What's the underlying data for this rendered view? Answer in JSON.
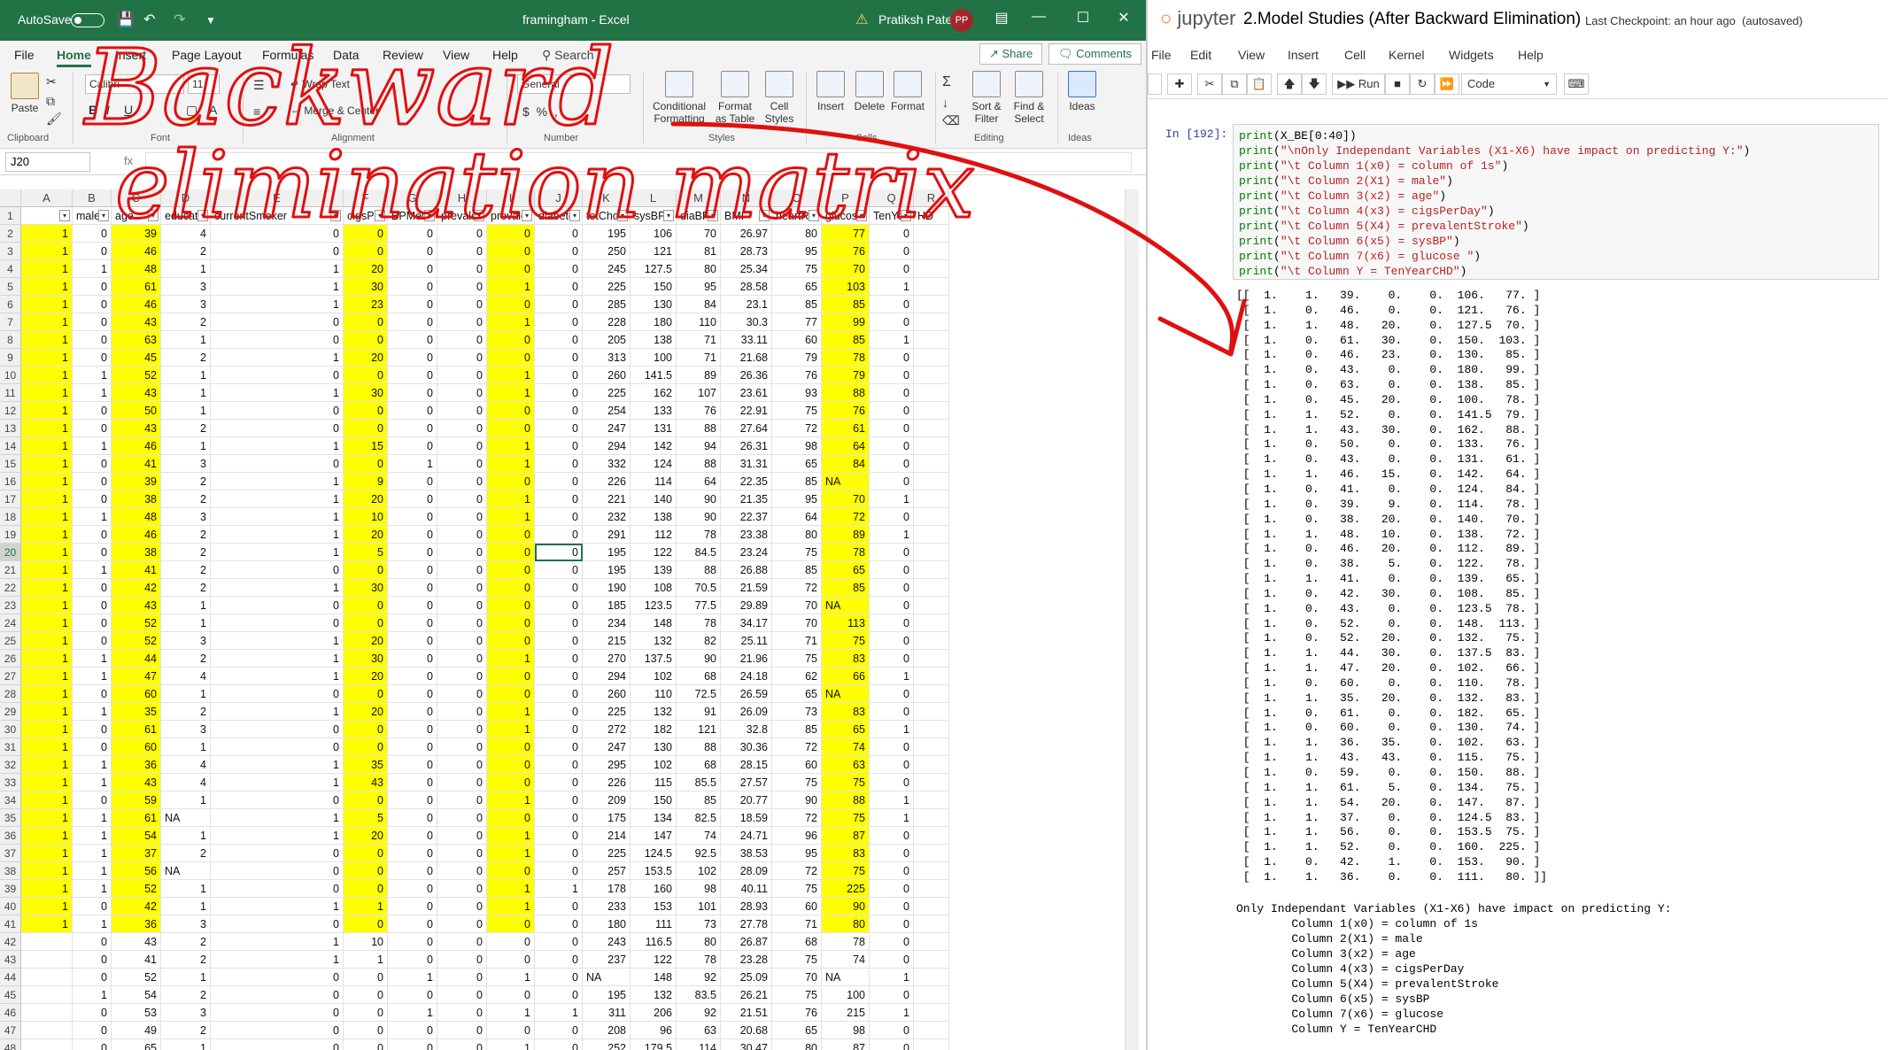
{
  "excel": {
    "autosave_label": "AutoSave",
    "toggle_state": "Off",
    "file_title": "framingham - Excel",
    "user_name": "Pratiksh Patel",
    "user_initials": "PP",
    "tabs": [
      "File",
      "Home",
      "Insert",
      "Page Layout",
      "Formulas",
      "Data",
      "Review",
      "View",
      "Help"
    ],
    "active_tab": "Home",
    "search_label": "Search",
    "share_label": "Share",
    "comments_label": "Comments",
    "ribbon": {
      "paste": "Paste",
      "clipboard": "Clipboard",
      "font_name": "Calibri",
      "font_size": "11",
      "font": "Font",
      "wrap": "Wrap Text",
      "merge": "Merge & Center",
      "alignment": "Alignment",
      "number_format": "General",
      "number": "Number",
      "conditional": "Conditional Formatting",
      "format_table": "Format as Table",
      "cell_styles": "Cell Styles",
      "styles": "Styles",
      "insert": "Insert",
      "delete": "Delete",
      "format": "Format",
      "cells": "Cells",
      "sort_filter": "Sort & Filter",
      "find_select": "Find & Select",
      "editing": "Editing",
      "ideas_btn": "Ideas",
      "ideas": "Ideas"
    },
    "name_box": "J20",
    "fx": "fx",
    "columns": [
      "A",
      "B",
      "C",
      "D",
      "E",
      "F",
      "G",
      "H",
      "I",
      "J",
      "K",
      "L",
      "M",
      "N",
      "O",
      "P",
      "Q",
      "R"
    ],
    "headers": [
      "",
      "male",
      "age",
      "educati",
      "currentSmoker",
      "cigsPer",
      "BPMed",
      "prevale",
      "prevale",
      "diabete",
      "totChol",
      "sysBP",
      "diaBP",
      "BMI",
      "heartRa",
      "glucose",
      "TenYea",
      "HD"
    ],
    "rows": [
      [
        "1",
        "0",
        "39",
        "4",
        "0",
        "0",
        "0",
        "0",
        "0",
        "0",
        "195",
        "106",
        "70",
        "26.97",
        "80",
        "77",
        "0"
      ],
      [
        "1",
        "0",
        "46",
        "2",
        "0",
        "0",
        "0",
        "0",
        "0",
        "0",
        "250",
        "121",
        "81",
        "28.73",
        "95",
        "76",
        "0"
      ],
      [
        "1",
        "1",
        "48",
        "1",
        "1",
        "20",
        "0",
        "0",
        "0",
        "0",
        "245",
        "127.5",
        "80",
        "25.34",
        "75",
        "70",
        "0"
      ],
      [
        "1",
        "0",
        "61",
        "3",
        "1",
        "30",
        "0",
        "0",
        "1",
        "0",
        "225",
        "150",
        "95",
        "28.58",
        "65",
        "103",
        "1"
      ],
      [
        "1",
        "0",
        "46",
        "3",
        "1",
        "23",
        "0",
        "0",
        "0",
        "0",
        "285",
        "130",
        "84",
        "23.1",
        "85",
        "85",
        "0"
      ],
      [
        "1",
        "0",
        "43",
        "2",
        "0",
        "0",
        "0",
        "0",
        "1",
        "0",
        "228",
        "180",
        "110",
        "30.3",
        "77",
        "99",
        "0"
      ],
      [
        "1",
        "0",
        "63",
        "1",
        "0",
        "0",
        "0",
        "0",
        "0",
        "0",
        "205",
        "138",
        "71",
        "33.11",
        "60",
        "85",
        "1"
      ],
      [
        "1",
        "0",
        "45",
        "2",
        "1",
        "20",
        "0",
        "0",
        "0",
        "0",
        "313",
        "100",
        "71",
        "21.68",
        "79",
        "78",
        "0"
      ],
      [
        "1",
        "1",
        "52",
        "1",
        "0",
        "0",
        "0",
        "0",
        "1",
        "0",
        "260",
        "141.5",
        "89",
        "26.36",
        "76",
        "79",
        "0"
      ],
      [
        "1",
        "1",
        "43",
        "1",
        "1",
        "30",
        "0",
        "0",
        "1",
        "0",
        "225",
        "162",
        "107",
        "23.61",
        "93",
        "88",
        "0"
      ],
      [
        "1",
        "0",
        "50",
        "1",
        "0",
        "0",
        "0",
        "0",
        "0",
        "0",
        "254",
        "133",
        "76",
        "22.91",
        "75",
        "76",
        "0"
      ],
      [
        "1",
        "0",
        "43",
        "2",
        "0",
        "0",
        "0",
        "0",
        "0",
        "0",
        "247",
        "131",
        "88",
        "27.64",
        "72",
        "61",
        "0"
      ],
      [
        "1",
        "1",
        "46",
        "1",
        "1",
        "15",
        "0",
        "0",
        "1",
        "0",
        "294",
        "142",
        "94",
        "26.31",
        "98",
        "64",
        "0"
      ],
      [
        "1",
        "0",
        "41",
        "3",
        "0",
        "0",
        "1",
        "0",
        "1",
        "0",
        "332",
        "124",
        "88",
        "31.31",
        "65",
        "84",
        "0"
      ],
      [
        "1",
        "0",
        "39",
        "2",
        "1",
        "9",
        "0",
        "0",
        "0",
        "0",
        "226",
        "114",
        "64",
        "22.35",
        "85",
        "NA",
        "0"
      ],
      [
        "1",
        "0",
        "38",
        "2",
        "1",
        "20",
        "0",
        "0",
        "1",
        "0",
        "221",
        "140",
        "90",
        "21.35",
        "95",
        "70",
        "1"
      ],
      [
        "1",
        "1",
        "48",
        "3",
        "1",
        "10",
        "0",
        "0",
        "1",
        "0",
        "232",
        "138",
        "90",
        "22.37",
        "64",
        "72",
        "0"
      ],
      [
        "1",
        "0",
        "46",
        "2",
        "1",
        "20",
        "0",
        "0",
        "0",
        "0",
        "291",
        "112",
        "78",
        "23.38",
        "80",
        "89",
        "1"
      ],
      [
        "1",
        "0",
        "38",
        "2",
        "1",
        "5",
        "0",
        "0",
        "0",
        "0",
        "195",
        "122",
        "84.5",
        "23.24",
        "75",
        "78",
        "0"
      ],
      [
        "1",
        "1",
        "41",
        "2",
        "0",
        "0",
        "0",
        "0",
        "0",
        "0",
        "195",
        "139",
        "88",
        "26.88",
        "85",
        "65",
        "0"
      ],
      [
        "1",
        "0",
        "42",
        "2",
        "1",
        "30",
        "0",
        "0",
        "0",
        "0",
        "190",
        "108",
        "70.5",
        "21.59",
        "72",
        "85",
        "0"
      ],
      [
        "1",
        "0",
        "43",
        "1",
        "0",
        "0",
        "0",
        "0",
        "0",
        "0",
        "185",
        "123.5",
        "77.5",
        "29.89",
        "70",
        "NA",
        "0"
      ],
      [
        "1",
        "0",
        "52",
        "1",
        "0",
        "0",
        "0",
        "0",
        "0",
        "0",
        "234",
        "148",
        "78",
        "34.17",
        "70",
        "113",
        "0"
      ],
      [
        "1",
        "0",
        "52",
        "3",
        "1",
        "20",
        "0",
        "0",
        "0",
        "0",
        "215",
        "132",
        "82",
        "25.11",
        "71",
        "75",
        "0"
      ],
      [
        "1",
        "1",
        "44",
        "2",
        "1",
        "30",
        "0",
        "0",
        "1",
        "0",
        "270",
        "137.5",
        "90",
        "21.96",
        "75",
        "83",
        "0"
      ],
      [
        "1",
        "1",
        "47",
        "4",
        "1",
        "20",
        "0",
        "0",
        "0",
        "0",
        "294",
        "102",
        "68",
        "24.18",
        "62",
        "66",
        "1"
      ],
      [
        "1",
        "0",
        "60",
        "1",
        "0",
        "0",
        "0",
        "0",
        "0",
        "0",
        "260",
        "110",
        "72.5",
        "26.59",
        "65",
        "NA",
        "0"
      ],
      [
        "1",
        "1",
        "35",
        "2",
        "1",
        "20",
        "0",
        "0",
        "1",
        "0",
        "225",
        "132",
        "91",
        "26.09",
        "73",
        "83",
        "0"
      ],
      [
        "1",
        "0",
        "61",
        "3",
        "0",
        "0",
        "0",
        "0",
        "1",
        "0",
        "272",
        "182",
        "121",
        "32.8",
        "85",
        "65",
        "1"
      ],
      [
        "1",
        "0",
        "60",
        "1",
        "0",
        "0",
        "0",
        "0",
        "0",
        "0",
        "247",
        "130",
        "88",
        "30.36",
        "72",
        "74",
        "0"
      ],
      [
        "1",
        "1",
        "36",
        "4",
        "1",
        "35",
        "0",
        "0",
        "0",
        "0",
        "295",
        "102",
        "68",
        "28.15",
        "60",
        "63",
        "0"
      ],
      [
        "1",
        "1",
        "43",
        "4",
        "1",
        "43",
        "0",
        "0",
        "0",
        "0",
        "226",
        "115",
        "85.5",
        "27.57",
        "75",
        "75",
        "0"
      ],
      [
        "1",
        "0",
        "59",
        "1",
        "0",
        "0",
        "0",
        "0",
        "1",
        "0",
        "209",
        "150",
        "85",
        "20.77",
        "90",
        "88",
        "1"
      ],
      [
        "1",
        "1",
        "61",
        "NA",
        "1",
        "5",
        "0",
        "0",
        "0",
        "0",
        "175",
        "134",
        "82.5",
        "18.59",
        "72",
        "75",
        "1"
      ],
      [
        "1",
        "1",
        "54",
        "1",
        "1",
        "20",
        "0",
        "0",
        "1",
        "0",
        "214",
        "147",
        "74",
        "24.71",
        "96",
        "87",
        "0"
      ],
      [
        "1",
        "1",
        "37",
        "2",
        "0",
        "0",
        "0",
        "0",
        "1",
        "0",
        "225",
        "124.5",
        "92.5",
        "38.53",
        "95",
        "83",
        "0"
      ],
      [
        "1",
        "1",
        "56",
        "NA",
        "0",
        "0",
        "0",
        "0",
        "0",
        "0",
        "257",
        "153.5",
        "102",
        "28.09",
        "72",
        "75",
        "0"
      ],
      [
        "1",
        "1",
        "52",
        "1",
        "0",
        "0",
        "0",
        "0",
        "1",
        "1",
        "178",
        "160",
        "98",
        "40.11",
        "75",
        "225",
        "0"
      ],
      [
        "1",
        "0",
        "42",
        "1",
        "1",
        "1",
        "0",
        "0",
        "1",
        "0",
        "233",
        "153",
        "101",
        "28.93",
        "60",
        "90",
        "0"
      ],
      [
        "1",
        "1",
        "36",
        "3",
        "0",
        "0",
        "0",
        "0",
        "0",
        "0",
        "180",
        "111",
        "73",
        "27.78",
        "71",
        "80",
        "0"
      ],
      [
        "",
        "0",
        "43",
        "2",
        "1",
        "10",
        "0",
        "0",
        "0",
        "0",
        "243",
        "116.5",
        "80",
        "26.87",
        "68",
        "78",
        "0"
      ],
      [
        "",
        "0",
        "41",
        "2",
        "1",
        "1",
        "0",
        "0",
        "0",
        "0",
        "237",
        "122",
        "78",
        "23.28",
        "75",
        "74",
        "0"
      ],
      [
        "",
        "0",
        "52",
        "1",
        "0",
        "0",
        "1",
        "0",
        "1",
        "0",
        "NA",
        "148",
        "92",
        "25.09",
        "70",
        "NA",
        "1"
      ],
      [
        "",
        "1",
        "54",
        "2",
        "0",
        "0",
        "0",
        "0",
        "0",
        "0",
        "195",
        "132",
        "83.5",
        "26.21",
        "75",
        "100",
        "0"
      ],
      [
        "",
        "0",
        "53",
        "3",
        "0",
        "0",
        "1",
        "0",
        "1",
        "1",
        "311",
        "206",
        "92",
        "21.51",
        "76",
        "215",
        "1"
      ],
      [
        "",
        "0",
        "49",
        "2",
        "0",
        "0",
        "0",
        "0",
        "0",
        "0",
        "208",
        "96",
        "63",
        "20.68",
        "65",
        "98",
        "0"
      ],
      [
        "",
        "0",
        "65",
        "1",
        "0",
        "0",
        "0",
        "0",
        "1",
        "0",
        "252",
        "179.5",
        "114",
        "30.47",
        "80",
        "87",
        "0"
      ]
    ]
  },
  "jupyter": {
    "logo": "jupyter",
    "notebook_title": "2.Model Studies (After Backward Elimination)",
    "checkpoint": "Last Checkpoint: an hour ago",
    "autosaved": "(autosaved)",
    "menu": [
      "File",
      "Edit",
      "View",
      "Insert",
      "Cell",
      "Kernel",
      "Widgets",
      "Help"
    ],
    "run_label": "Run",
    "cell_type": "Code",
    "prompt": "In [192]:",
    "code_lines": [
      "print(X_BE[0:40])",
      "print(\"\\nOnly Independant Variables (X1-X6) have impact on predicting Y:\")",
      "print(\"\\t Column 1(x0) = column of 1s\")",
      "print(\"\\t Column 2(X1) = male\")",
      "print(\"\\t Column 3(x2) = age\")",
      "print(\"\\t Column 4(x3) = cigsPerDay\")",
      "print(\"\\t Column 5(X4) = prevalentStroke\")",
      "print(\"\\t Column 6(x5) = sysBP\")",
      "print(\"\\t Column 7(x6) = glucose \")",
      "print(\"\\t Column Y = TenYearCHD\")"
    ],
    "matrix_lines": [
      "[[  1.    1.   39.    0.    0.  106.   77. ]",
      " [  1.    0.   46.    0.    0.  121.   76. ]",
      " [  1.    1.   48.   20.    0.  127.5  70. ]",
      " [  1.    0.   61.   30.    0.  150.  103. ]",
      " [  1.    0.   46.   23.    0.  130.   85. ]",
      " [  1.    0.   43.    0.    0.  180.   99. ]",
      " [  1.    0.   63.    0.    0.  138.   85. ]",
      " [  1.    0.   45.   20.    0.  100.   78. ]",
      " [  1.    1.   52.    0.    0.  141.5  79. ]",
      " [  1.    1.   43.   30.    0.  162.   88. ]",
      " [  1.    0.   50.    0.    0.  133.   76. ]",
      " [  1.    0.   43.    0.    0.  131.   61. ]",
      " [  1.    1.   46.   15.    0.  142.   64. ]",
      " [  1.    0.   41.    0.    0.  124.   84. ]",
      " [  1.    0.   39.    9.    0.  114.   78. ]",
      " [  1.    0.   38.   20.    0.  140.   70. ]",
      " [  1.    1.   48.   10.    0.  138.   72. ]",
      " [  1.    0.   46.   20.    0.  112.   89. ]",
      " [  1.    0.   38.    5.    0.  122.   78. ]",
      " [  1.    1.   41.    0.    0.  139.   65. ]",
      " [  1.    0.   42.   30.    0.  108.   85. ]",
      " [  1.    0.   43.    0.    0.  123.5  78. ]",
      " [  1.    0.   52.    0.    0.  148.  113. ]",
      " [  1.    0.   52.   20.    0.  132.   75. ]",
      " [  1.    1.   44.   30.    0.  137.5  83. ]",
      " [  1.    1.   47.   20.    0.  102.   66. ]",
      " [  1.    0.   60.    0.    0.  110.   78. ]",
      " [  1.    1.   35.   20.    0.  132.   83. ]",
      " [  1.    0.   61.    0.    0.  182.   65. ]",
      " [  1.    0.   60.    0.    0.  130.   74. ]",
      " [  1.    1.   36.   35.    0.  102.   63. ]",
      " [  1.    1.   43.   43.    0.  115.   75. ]",
      " [  1.    0.   59.    0.    0.  150.   88. ]",
      " [  1.    1.   61.    5.    0.  134.   75. ]",
      " [  1.    1.   54.   20.    0.  147.   87. ]",
      " [  1.    1.   37.    0.    0.  124.5  83. ]",
      " [  1.    1.   56.    0.    0.  153.5  75. ]",
      " [  1.    1.   52.    0.    0.  160.  225. ]",
      " [  1.    0.   42.    1.    0.  153.   90. ]",
      " [  1.    1.   36.    0.    0.  111.   80. ]]"
    ],
    "output_lines": [
      "Only Independant Variables (X1-X6) have impact on predicting Y:",
      "        Column 1(x0) = column of 1s",
      "        Column 2(X1) = male",
      "        Column 3(x2) = age",
      "        Column 4(x3) = cigsPerDay",
      "        Column 5(X4) = prevalentStroke",
      "        Column 6(x5) = sysBP",
      "        Column 7(x6) = glucose",
      "        Column Y = TenYearCHD"
    ]
  },
  "annotation": {
    "line1": "Backward",
    "line2": "elimination matrix",
    "color": "#e01010"
  }
}
